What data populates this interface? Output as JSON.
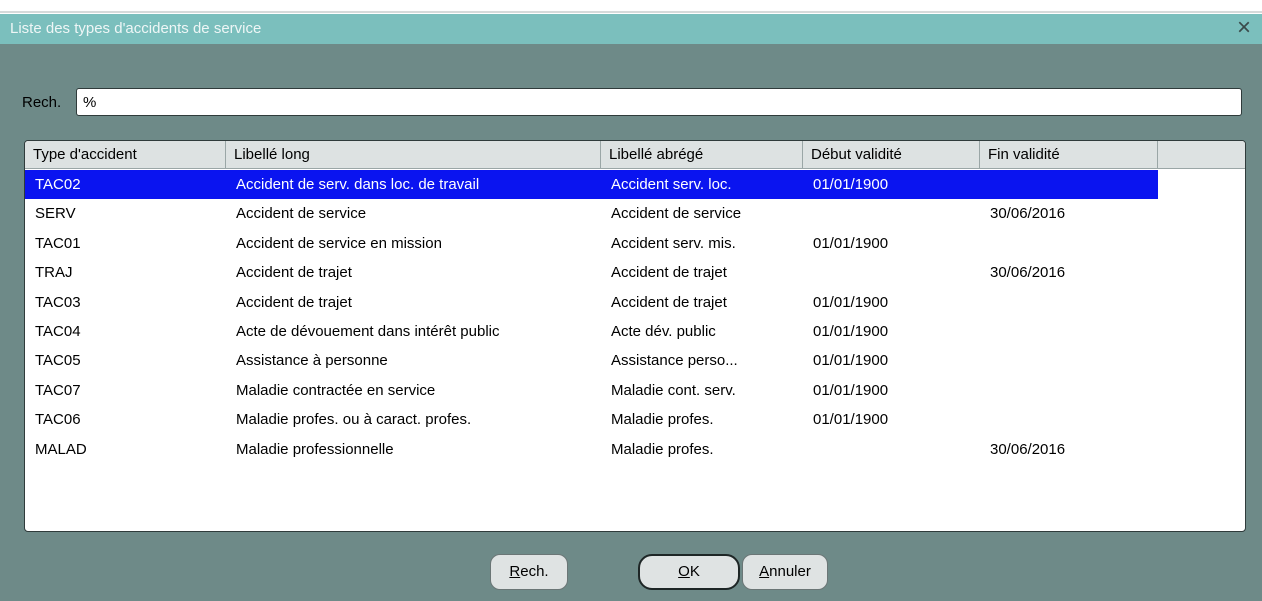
{
  "window": {
    "title": "Liste des types d'accidents de service",
    "close_glyph": "×",
    "close_icon": "close-icon"
  },
  "search": {
    "label": "Rech.",
    "value": "%"
  },
  "grid": {
    "columns": [
      "Type d'accident",
      "Libellé long",
      "Libellé abrégé",
      "Début validité",
      "Fin validité"
    ],
    "selected_row": 0,
    "selection_color": "#0a14f0",
    "rows": [
      [
        "TAC02",
        "Accident de serv. dans loc. de travail",
        "Accident serv. loc.",
        "01/01/1900",
        ""
      ],
      [
        "SERV",
        "Accident de service",
        "Accident de service",
        "",
        "30/06/2016"
      ],
      [
        "TAC01",
        "Accident de service en mission",
        "Accident serv. mis.",
        "01/01/1900",
        ""
      ],
      [
        "TRAJ",
        "Accident de trajet",
        "Accident de trajet",
        "",
        "30/06/2016"
      ],
      [
        "TAC03",
        "Accident de trajet",
        "Accident de trajet",
        "01/01/1900",
        ""
      ],
      [
        "TAC04",
        "Acte de dévouement dans intérêt public",
        "Acte dév. public",
        "01/01/1900",
        ""
      ],
      [
        "TAC05",
        "Assistance à personne",
        "Assistance perso...",
        "01/01/1900",
        ""
      ],
      [
        "TAC07",
        "Maladie contractée en service",
        "Maladie cont. serv.",
        "01/01/1900",
        ""
      ],
      [
        "TAC06",
        "Maladie profes. ou à caract. profes.",
        "Maladie profes.",
        "01/01/1900",
        ""
      ],
      [
        "MALAD",
        "Maladie professionnelle",
        "Maladie profes.",
        "",
        "30/06/2016"
      ]
    ]
  },
  "buttons": {
    "search": {
      "mnemonic": "R",
      "rest": "ech."
    },
    "ok": {
      "mnemonic": "O",
      "rest": "K"
    },
    "cancel": {
      "mnemonic": "A",
      "rest": "nnuler"
    }
  }
}
